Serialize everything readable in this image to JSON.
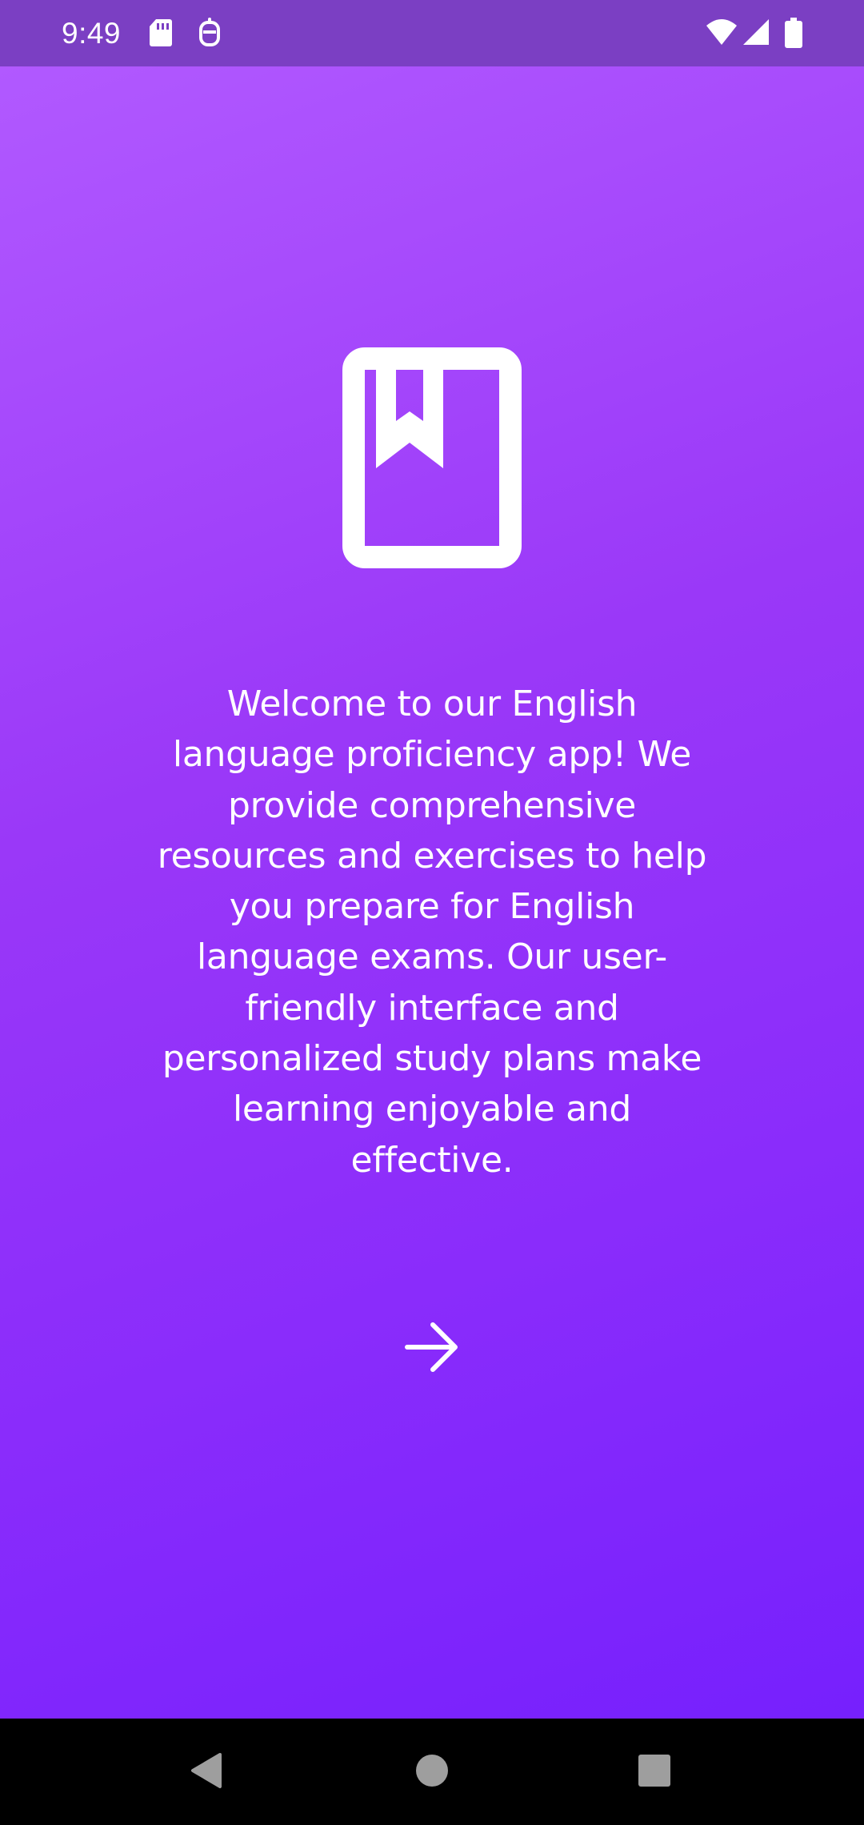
{
  "status_bar": {
    "time": "9:49",
    "left_icons": [
      "sd-card-icon",
      "app-notification-icon"
    ],
    "right_icons": [
      "wifi-icon",
      "cellular-signal-icon",
      "battery-icon"
    ]
  },
  "main": {
    "logo_icon": "bookmarked-book-icon",
    "welcome_text": "Welcome to our English language proficiency app! We provide comprehensive resources and exercises to help you prepare for English language exams. Our user-friendly interface and personalized study plans make learning enjoyable and effective.",
    "next_icon": "arrow-right-icon"
  },
  "nav_bar": {
    "buttons": [
      "back-icon",
      "home-icon",
      "recents-icon"
    ]
  },
  "colors": {
    "status_bar": "#7b3fc3",
    "gradient_start": "#b159ff",
    "gradient_end": "#7620fd",
    "foreground": "#ffffff",
    "nav_bar": "#000000",
    "nav_icons": "#9e9e9e"
  }
}
